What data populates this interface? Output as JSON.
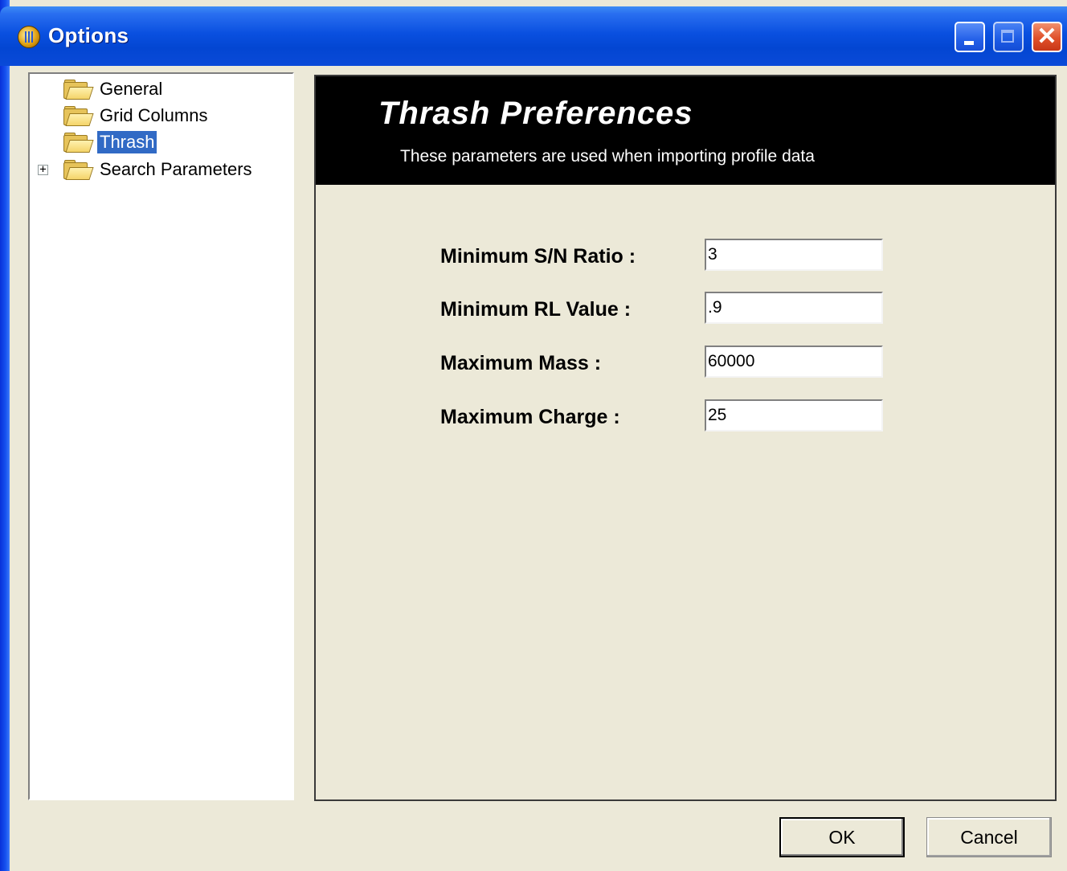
{
  "window": {
    "title": "Options"
  },
  "title_buttons": {
    "minimize_icon": "minimize-icon",
    "maximize_icon": "maximize-icon",
    "close_icon": "close-icon",
    "close_glyph": "✕"
  },
  "tree": {
    "items": [
      {
        "label": "General",
        "icon": "folder-open-icon",
        "selected": false,
        "expandable": false
      },
      {
        "label": "Grid Columns",
        "icon": "folder-open-icon",
        "selected": false,
        "expandable": false
      },
      {
        "label": "Thrash",
        "icon": "folder-open-icon",
        "selected": true,
        "expandable": false
      },
      {
        "label": "Search Parameters",
        "icon": "folder-open-icon",
        "selected": false,
        "expandable": true,
        "expander": "+"
      }
    ]
  },
  "panel": {
    "title": "Thrash Preferences",
    "subtitle": "These parameters are used when importing profile data",
    "fields": [
      {
        "label": "Minimum S/N Ratio :",
        "value": "3"
      },
      {
        "label": "Minimum RL Value :",
        "value": ".9"
      },
      {
        "label": "Maximum Mass :",
        "value": "60000"
      },
      {
        "label": "Maximum Charge :",
        "value": "25"
      }
    ]
  },
  "buttons": {
    "ok": "OK",
    "cancel": "Cancel"
  },
  "colors": {
    "title_bar": "#0a50e0",
    "selection": "#316ac5",
    "dialog_bg": "#ece9d8",
    "header_bg": "#000000",
    "close_button": "#e0502a"
  }
}
